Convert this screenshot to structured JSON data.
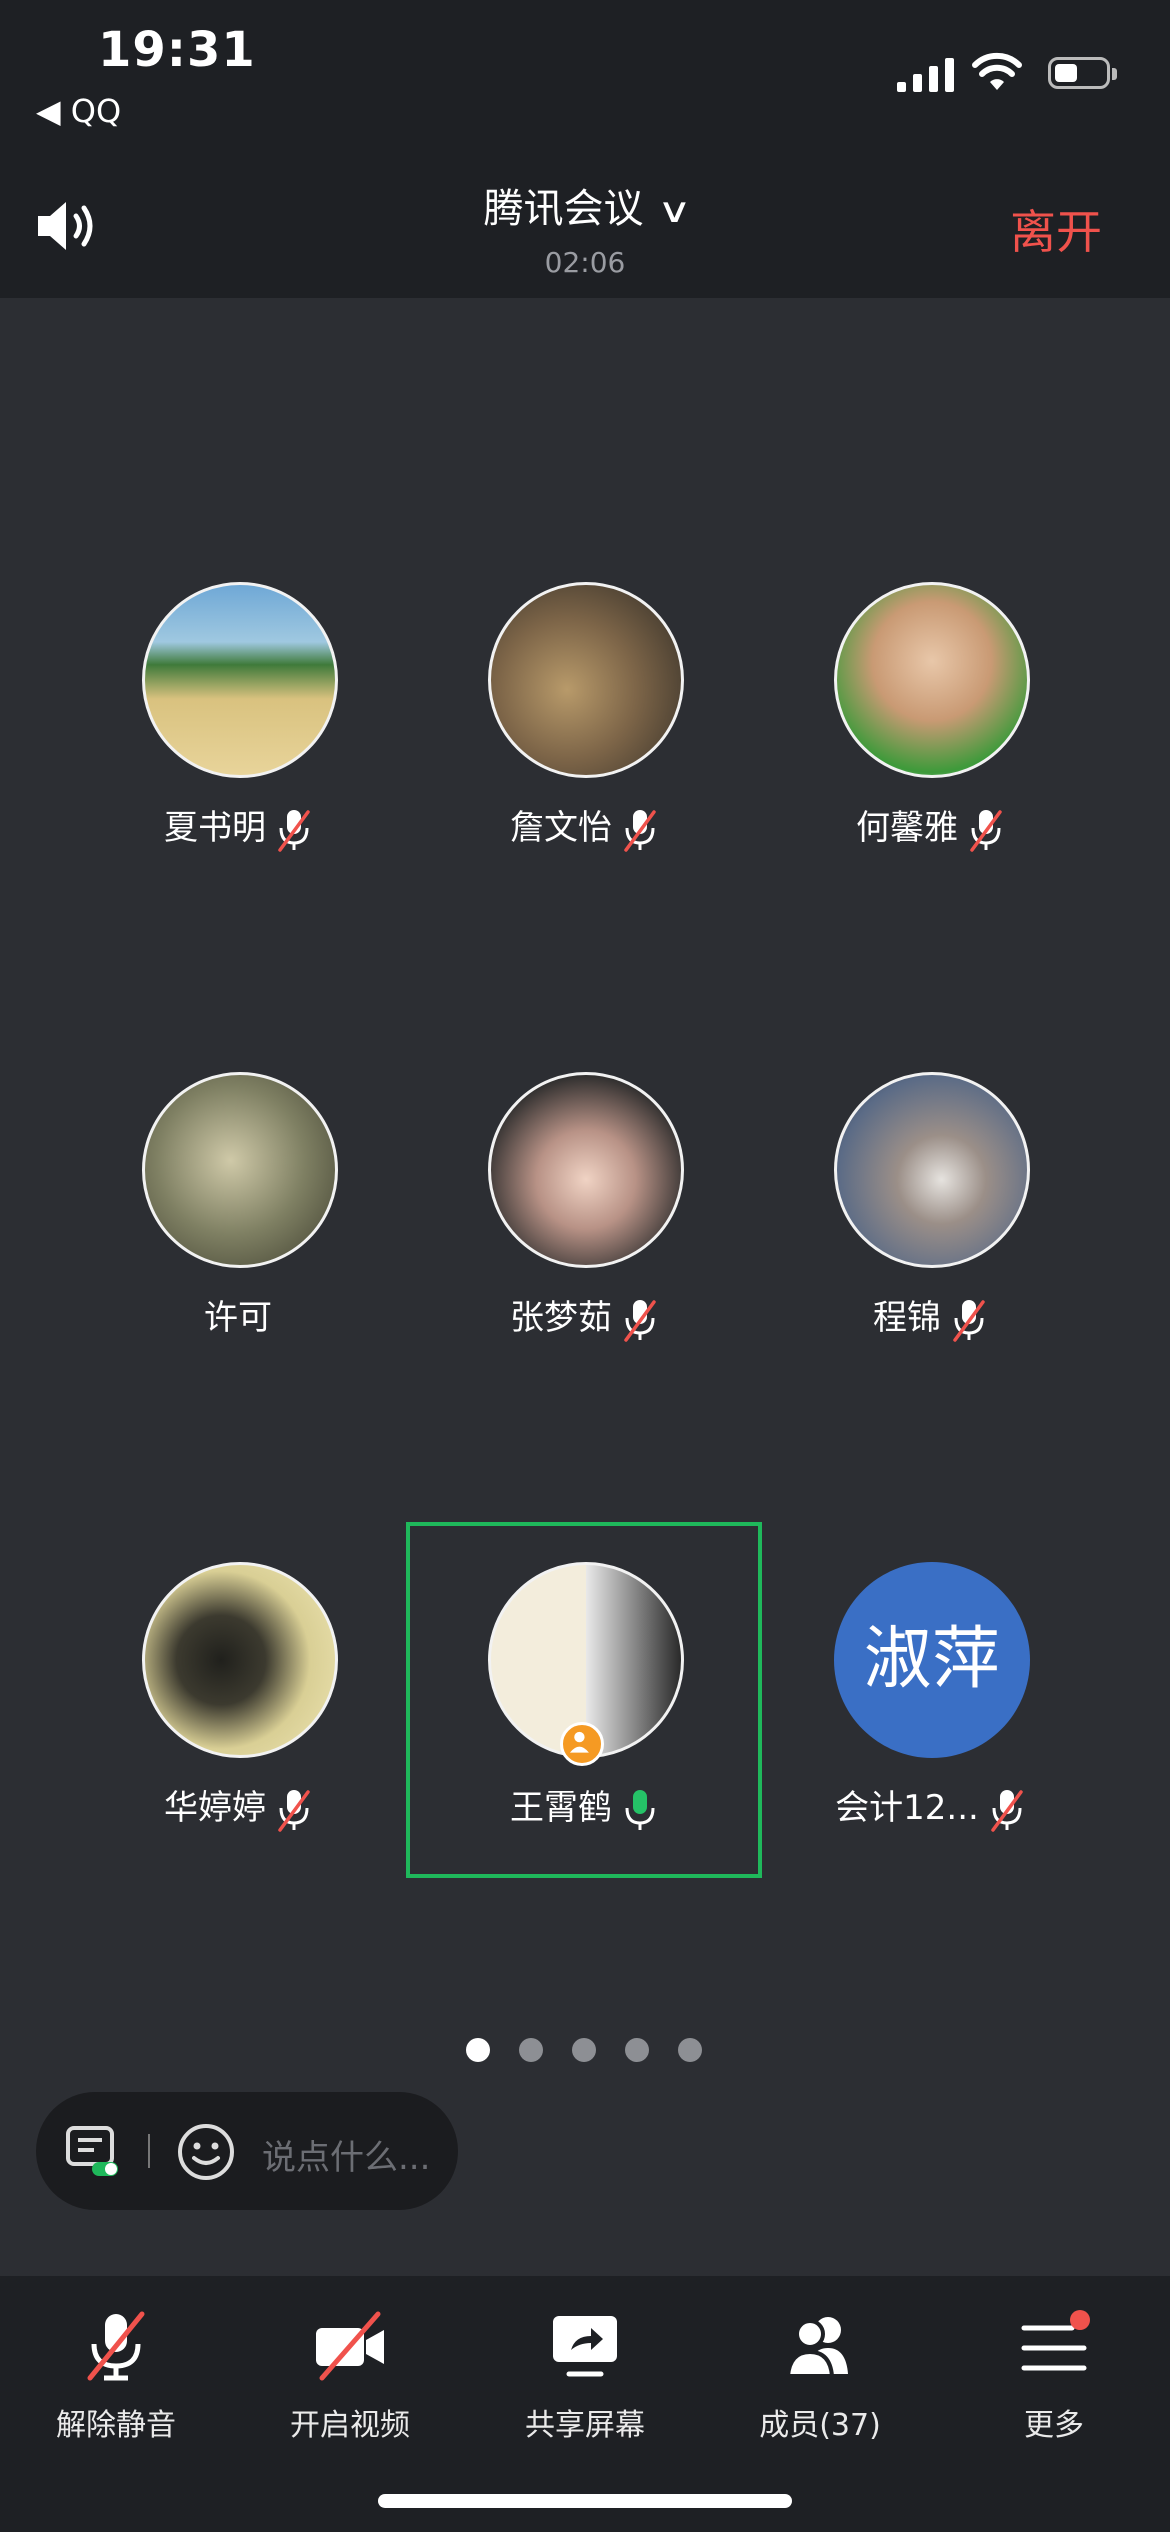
{
  "status": {
    "time": "19:31",
    "back": "◀ QQ"
  },
  "header": {
    "title": "腾讯会议",
    "timer": "02:06",
    "leave": "离开"
  },
  "participants": [
    {
      "name": "夏书明",
      "muted": true
    },
    {
      "name": "詹文怡",
      "muted": true
    },
    {
      "name": "何馨雅",
      "muted": true
    },
    {
      "name": "许可",
      "muted": false
    },
    {
      "name": "张梦茹",
      "muted": true
    },
    {
      "name": "程锦",
      "muted": true
    },
    {
      "name": "华婷婷",
      "muted": true
    },
    {
      "name": "王霄鹤",
      "muted": false,
      "speaking": true
    },
    {
      "name": "会计12...",
      "muted": true,
      "initials": "淑萍"
    }
  ],
  "pager": {
    "count": 5,
    "active": 0
  },
  "chat": {
    "placeholder": "说点什么..."
  },
  "toolbar": {
    "unmute": "解除静音",
    "video": "开启视频",
    "share": "共享屏幕",
    "members": "成员(37)",
    "more": "更多"
  },
  "colors": {
    "leave": "#f0524c",
    "highlight": "#1fb85b",
    "avatar_blue": "#3a6fc5",
    "badge": "#f59a23"
  }
}
